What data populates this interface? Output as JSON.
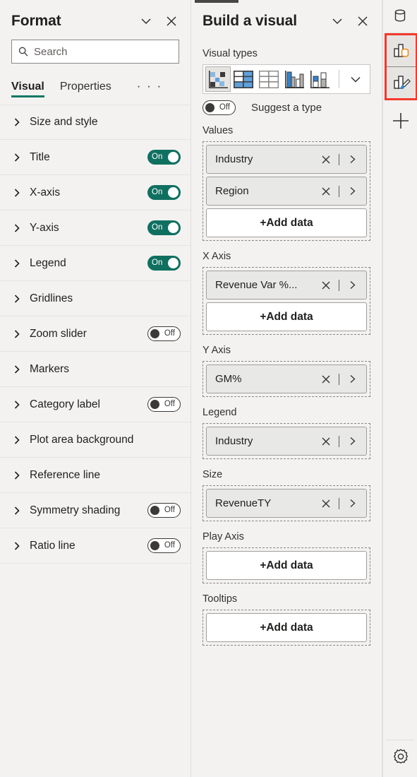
{
  "format_panel": {
    "title": "Format",
    "collapse_icon": "chevron-down-icon",
    "close_icon": "close-icon",
    "search": {
      "placeholder": "Search",
      "value": "",
      "icon": "search-icon"
    },
    "tabs": [
      {
        "label": "Visual",
        "active": true
      },
      {
        "label": "Properties",
        "active": false
      }
    ],
    "overflow_label": "· · ·",
    "rows": [
      {
        "label": "Size and style",
        "toggle": null
      },
      {
        "label": "Title",
        "toggle": "On"
      },
      {
        "label": "X-axis",
        "toggle": "On"
      },
      {
        "label": "Y-axis",
        "toggle": "On"
      },
      {
        "label": "Legend",
        "toggle": "On"
      },
      {
        "label": "Gridlines",
        "toggle": null
      },
      {
        "label": "Zoom slider",
        "toggle": "Off"
      },
      {
        "label": "Markers",
        "toggle": null
      },
      {
        "label": "Category label",
        "toggle": "Off"
      },
      {
        "label": "Plot area background",
        "toggle": null
      },
      {
        "label": "Reference line",
        "toggle": null
      },
      {
        "label": "Symmetry shading",
        "toggle": "Off"
      },
      {
        "label": "Ratio line",
        "toggle": "Off"
      }
    ]
  },
  "build_panel": {
    "title": "Build a visual",
    "collapse_icon": "chevron-down-icon",
    "close_icon": "close-icon",
    "visual_types_label": "Visual types",
    "visual_types": [
      {
        "name": "scatter-chart",
        "selected": true
      },
      {
        "name": "matrix-table",
        "selected": false
      },
      {
        "name": "table",
        "selected": false
      },
      {
        "name": "clustered-column-chart",
        "selected": false
      },
      {
        "name": "stacked-column-chart",
        "selected": false
      }
    ],
    "more_visuals_icon": "chevron-down-icon",
    "suggest": {
      "toggle": "Off",
      "label": "Suggest a type"
    },
    "wells": [
      {
        "label": "Values",
        "fields": [
          "Industry",
          "Region"
        ],
        "add_label": "+Add data"
      },
      {
        "label": "X Axis",
        "fields": [
          "Revenue Var %..."
        ],
        "add_label": "+Add data"
      },
      {
        "label": "Y Axis",
        "fields": [
          "GM%"
        ],
        "add_label": null
      },
      {
        "label": "Legend",
        "fields": [
          "Industry"
        ],
        "add_label": null
      },
      {
        "label": "Size",
        "fields": [
          "RevenueTY"
        ],
        "add_label": null
      },
      {
        "label": "Play Axis",
        "fields": [],
        "add_label": "+Add data"
      },
      {
        "label": "Tooltips",
        "fields": [],
        "add_label": "+Add data"
      }
    ]
  },
  "rail": {
    "items": [
      {
        "name": "data-pane-icon",
        "highlighted": false
      },
      {
        "name": "build-visual-icon",
        "highlighted": true
      },
      {
        "name": "format-visual-icon",
        "highlighted": true
      }
    ],
    "add_icon": "plus-icon",
    "settings_icon": "gear-icon"
  },
  "colors": {
    "toggle_on": "#0f7060",
    "tab_underline": "#117865",
    "highlight_box": "#f2392c",
    "panel_bg": "#f3f2f1",
    "chip_bg": "#e8e8e6",
    "accent_blue": "#2f82d0",
    "accent_orange": "#e8871a"
  }
}
